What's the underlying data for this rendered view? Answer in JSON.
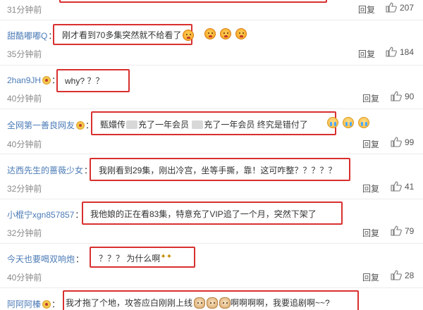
{
  "top": {
    "time": "31分钟前",
    "reply": "回复",
    "likes": "207"
  },
  "comments": [
    {
      "user": "甜酷嘟嘟Q",
      "text": "刚才看到70多集突然就不给看了",
      "time": "35分钟前",
      "reply": "回复",
      "likes": "184"
    },
    {
      "user": "2han9JH",
      "text": "why? ？？",
      "time": "40分钟前",
      "reply": "回复",
      "likes": "90"
    },
    {
      "user": "全网第一善良网友",
      "text_a": "甄嬛传",
      "text_b": "充了一年会员",
      "text_c": "充了一年会员 终究是错付了",
      "time": "40分钟前",
      "reply": "回复",
      "likes": "99"
    },
    {
      "user": "达西先生的蔷薇少女",
      "text": "我刚看到29集，刚出冷宫，坐等手撕，靠！这可咋整？？？？？",
      "time": "32分钟前",
      "reply": "回复",
      "likes": "41"
    },
    {
      "user": "小棍宁xgn857857",
      "text": "我他娘的正在看83集，特意充了VIP追了一个月，突然下架了",
      "time": "32分钟前",
      "reply": "回复",
      "likes": "79"
    },
    {
      "user": "今天也要喝双响炮",
      "text": "？？？ 为什么啊",
      "time": "40分钟前",
      "reply": "回复",
      "likes": "28"
    },
    {
      "user": "阿阿阿榛",
      "text_a": "我才拖了个地，攻答应白刚刚上线",
      "text_b": "啊啊啊啊，我要追剧啊~~?"
    }
  ],
  "icons": {
    "like": "thumbs-up-icon",
    "vip_badge": "vip-badge-icon",
    "emoji_angry": "angry-face-icon",
    "emoji_cry": "crying-face-icon",
    "emoji_cat": "cat-face-icon"
  },
  "colors": {
    "username": "#4b7bb6",
    "highlight_box": "#d8302f",
    "time": "#8a8a8a"
  }
}
